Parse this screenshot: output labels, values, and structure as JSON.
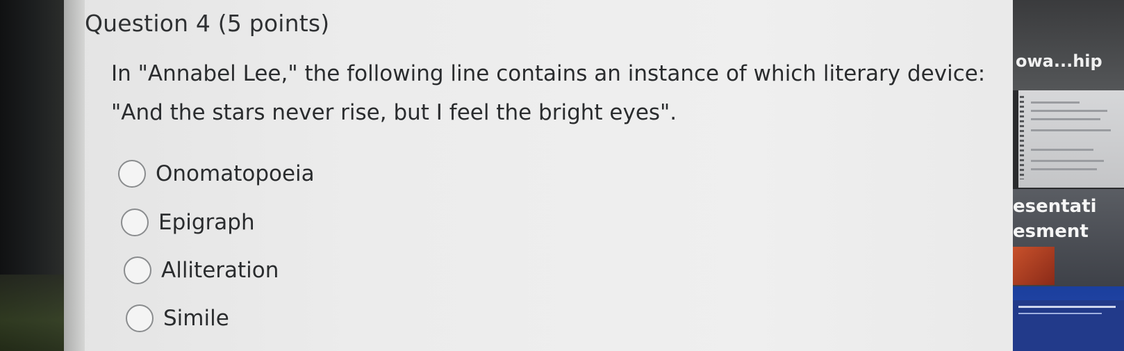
{
  "question": {
    "title": "Question 4 (5 points)",
    "text_line1": "In \"Annabel Lee,\" the following line contains an instance of which literary device:",
    "text_line2": "\"And the stars never rise, but I feel the bright eyes\"."
  },
  "options": [
    {
      "label": "Onomatopoeia",
      "selected": false
    },
    {
      "label": "Epigraph",
      "selected": false
    },
    {
      "label": "Alliteration",
      "selected": false
    },
    {
      "label": "Simile",
      "selected": false
    }
  ],
  "side_panel": {
    "video_title": "owa...hip",
    "slide_line1": "esentati",
    "slide_line2": "esment"
  }
}
